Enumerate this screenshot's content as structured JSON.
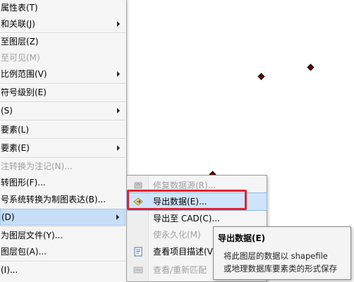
{
  "main_menu": {
    "items": [
      {
        "label": "属性表(T)",
        "disabled": false,
        "submenu": false
      },
      {
        "label": "和关联(J)",
        "disabled": false,
        "submenu": true
      },
      {
        "label": "至图层(Z)",
        "disabled": false,
        "submenu": false
      },
      {
        "label": "至可见(M)",
        "disabled": true,
        "submenu": false
      },
      {
        "label": "比例范围(V)",
        "disabled": false,
        "submenu": true
      },
      {
        "label": "符号级别(E)",
        "disabled": false,
        "submenu": false
      },
      {
        "label": "(S)",
        "disabled": false,
        "submenu": true
      },
      {
        "label": "要素(L)",
        "disabled": false,
        "submenu": false
      },
      {
        "label": "要素(E)",
        "disabled": false,
        "submenu": true
      },
      {
        "label": "注转换为注记(N)...",
        "disabled": true,
        "submenu": false
      },
      {
        "label": "转图形(F)...",
        "disabled": false,
        "submenu": false
      },
      {
        "label": "号系统转换为制图表达(B)...",
        "disabled": false,
        "submenu": false
      },
      {
        "label": "(D)",
        "disabled": false,
        "submenu": true,
        "highlighted": true
      },
      {
        "label": "为图层文件(Y)...",
        "disabled": false,
        "submenu": false
      },
      {
        "label": "图层包(A)...",
        "disabled": false,
        "submenu": false
      },
      {
        "label": "(I)...",
        "disabled": false,
        "submenu": false
      }
    ]
  },
  "data_submenu": {
    "items": [
      {
        "label": "修复数据源(R)...",
        "disabled": true,
        "icon": "repair-data-source-icon"
      },
      {
        "label": "导出数据(E)...",
        "disabled": false,
        "selected": true,
        "icon": "export-data-icon"
      },
      {
        "label": "导出至 CAD(C)...",
        "disabled": false,
        "icon": ""
      },
      {
        "label": "使永久化(M)",
        "disabled": true,
        "icon": ""
      },
      {
        "label": "查看项目描述(V)",
        "disabled": false,
        "icon": "item-description-icon"
      },
      {
        "label": "查看/重新匹配",
        "disabled": true,
        "icon": "rematch-icon"
      }
    ]
  },
  "tooltip": {
    "title": "导出数据(E)",
    "line1": "将此图层的数据以 shapefile",
    "line2": "或地理数据库要素类的形式保存"
  },
  "colors": {
    "menu_bg": "#f5f5f5",
    "highlight": "#c6def7",
    "annotation_red": "#e1232b",
    "point": "#6b0000"
  }
}
